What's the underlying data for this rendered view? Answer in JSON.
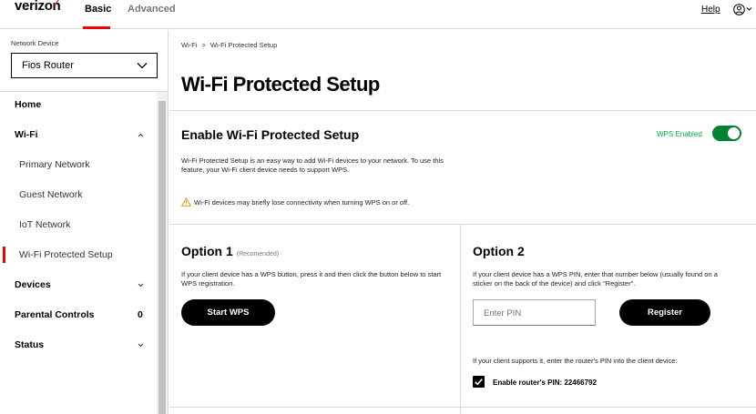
{
  "header": {
    "logo": "verizon",
    "logo_mark": "✓",
    "tabs": [
      {
        "label": "Basic",
        "active": true
      },
      {
        "label": "Advanced",
        "active": false
      }
    ],
    "help_label": "Help",
    "user_icon": "user-circle-icon"
  },
  "sidebar": {
    "device_label": "Network Device",
    "device_value": "Fios Router",
    "items": [
      {
        "label": "Home",
        "level": "top"
      },
      {
        "label": "Wi-Fi",
        "level": "top",
        "expanded": true
      },
      {
        "label": "Primary Network",
        "level": "sub"
      },
      {
        "label": "Guest Network",
        "level": "sub"
      },
      {
        "label": "IoT Network",
        "level": "sub"
      },
      {
        "label": "Wi-Fi Protected Setup",
        "level": "sub",
        "active": true
      },
      {
        "label": "Devices",
        "level": "top",
        "expanded": false
      },
      {
        "label": "Parental Controls",
        "level": "top",
        "badge": "0"
      },
      {
        "label": "Status",
        "level": "top",
        "expanded": false
      }
    ]
  },
  "breadcrumb": {
    "items": [
      "Wi-Fi",
      "Wi-Fi Protected Setup"
    ],
    "separator": ">"
  },
  "page": {
    "title": "Wi-Fi Protected Setup"
  },
  "card": {
    "title": "Enable Wi-Fi Protected Setup",
    "wps_status": "WPS Enabled",
    "wps_enabled": true,
    "description": "Wi-Fi Protected Setup is an easy way to add Wi-Fi devices to your network. To use this feature, your Wi-Fi client device needs to support WPS.",
    "warning": "Wi-Fi devices may briefly lose connectivity when turning WPS on or off."
  },
  "option1": {
    "title": "Option 1",
    "tag": "(Recomended)",
    "description": "If your client device has a WPS button, press it and then click the button below to start WPS registration.",
    "button": "Start WPS"
  },
  "option2": {
    "title": "Option 2",
    "description": "If your client device has a WPS PIN, enter that number below (usually found on a sticker on the back of the device) and click \"Register\".",
    "pin_placeholder": "Enter PIN",
    "button": "Register",
    "router_pin_note": "If your client supports it, enter the router's PIN into the client device:",
    "router_pin_label": "Enable router's PIN: 22466792",
    "router_pin_checked": true
  },
  "colors": {
    "brand_red": "#ee0000",
    "toggle_green": "#008331",
    "status_green": "#00ac3e",
    "button_black": "#000000"
  }
}
